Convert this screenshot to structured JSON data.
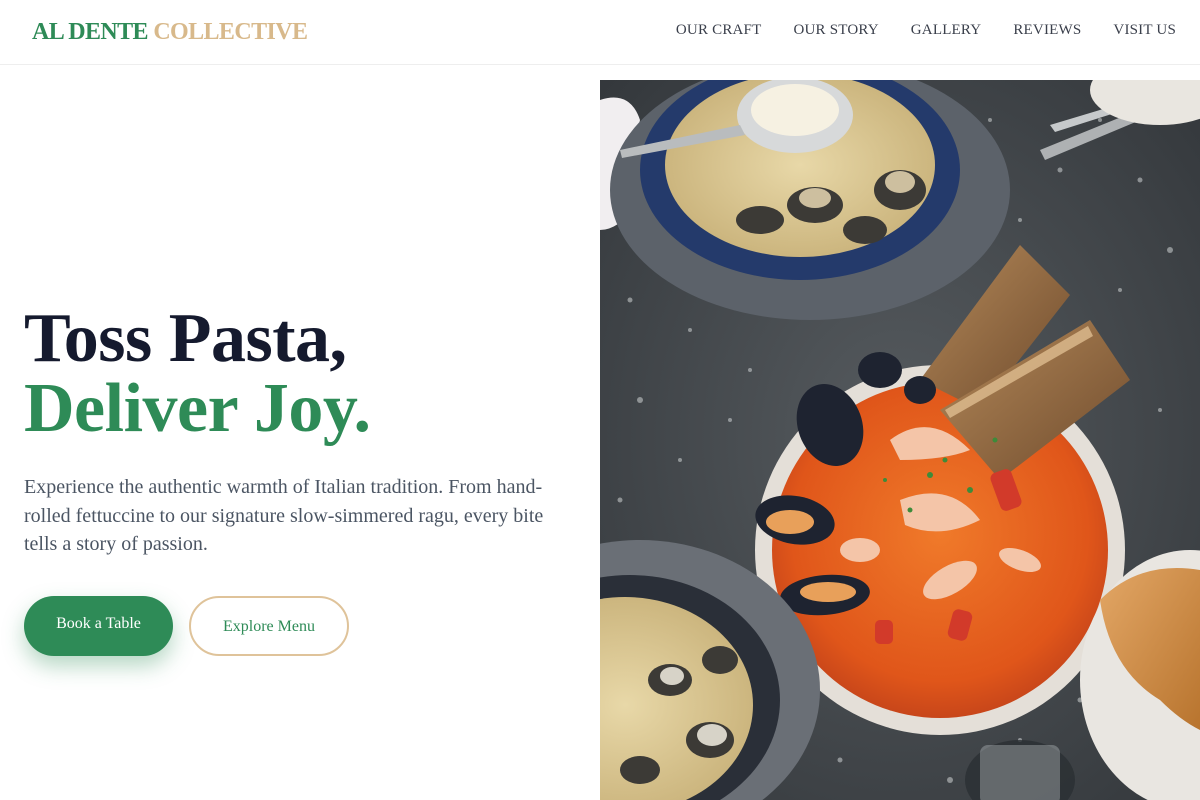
{
  "header": {
    "logo_primary": "AL DENTE",
    "logo_secondary": "COLLECTIVE",
    "nav": [
      {
        "label": "OUR CRAFT"
      },
      {
        "label": "OUR STORY"
      },
      {
        "label": "GALLERY"
      },
      {
        "label": "REVIEWS"
      },
      {
        "label": "VISIT US"
      }
    ]
  },
  "hero": {
    "headline_line1": "Toss Pasta,",
    "headline_line2": "Deliver Joy.",
    "description": "Experience the authentic warmth of Italian tradition. From hand-rolled fettuccine to our signature slow-simmered ragu, every bite tells a story of passion.",
    "primary_button": "Book a Table",
    "secondary_button": "Explore Menu"
  },
  "colors": {
    "brand_green": "#2e8b57",
    "brand_gold": "#d8b98b",
    "heading_navy": "#151a2e",
    "body_gray": "#4b5563"
  }
}
